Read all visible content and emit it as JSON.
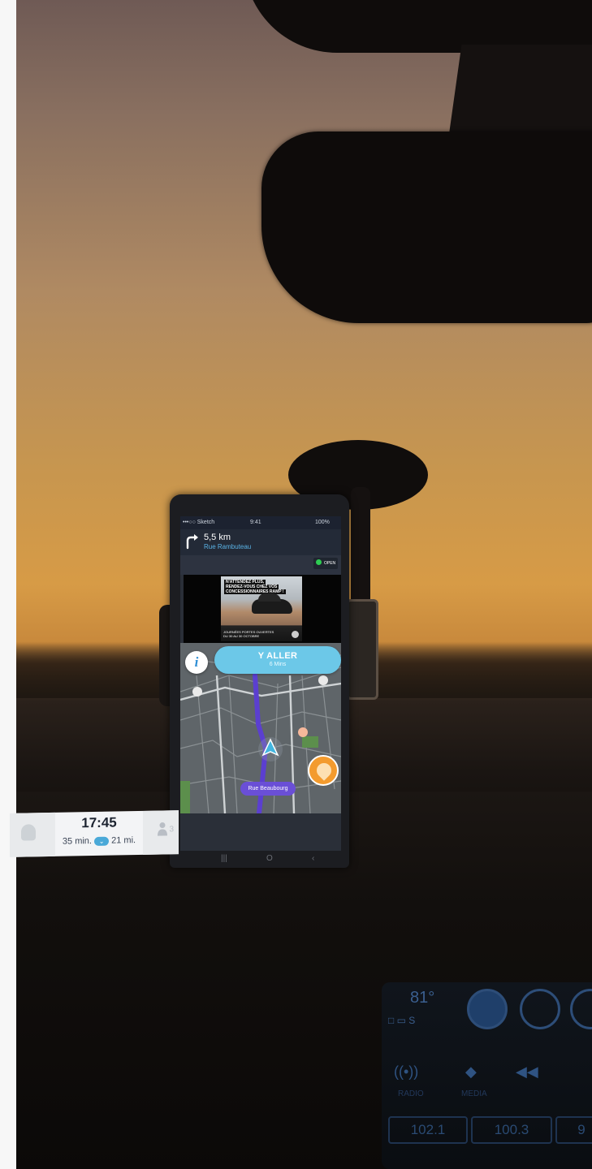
{
  "status_bar": {
    "carrier": "•••○○ Sketch",
    "time": "9:41",
    "battery": "100%"
  },
  "navigation": {
    "distance": "5,5 km",
    "street": "Rue Rambuteau",
    "turn_icon": "turn-right-icon"
  },
  "open_badge": {
    "label": "OPEN",
    "dot_color": "#2ecc52"
  },
  "ad": {
    "headline_1": "N'ATTENDEZ PLUS,",
    "headline_2": "RENDEZ-VOUS CHEZ VOS",
    "headline_3": "CONCESSIONNAIRES RAMP !",
    "footer_1": "JOURNÉES PORTES OUVERTES",
    "footer_2": "DU 30 AU 30 OCTOBRE"
  },
  "go_button": {
    "label": "Y ALLER",
    "sub": "6 Mins",
    "color": "#6cc8e8"
  },
  "map": {
    "current_street": "Rue Beaubourg",
    "route_color": "#5b3fd0",
    "street_pill_color": "#6a4fd6"
  },
  "bottom": {
    "eta_time": "17:45",
    "duration": "35 min.",
    "distance": "21 mi.",
    "riders": "3"
  },
  "system_nav": {
    "recent": "|||",
    "home": "O",
    "back": "‹"
  },
  "console": {
    "temperature": "81°",
    "temp_sub": "□ ▭ S",
    "btn_radio": "((•))",
    "btn_media": "◆",
    "btn_prev": "◀◀",
    "label_radio": "RADIO",
    "label_media": "MEDIA",
    "stations": [
      "102.1",
      "100.3",
      "9"
    ]
  }
}
